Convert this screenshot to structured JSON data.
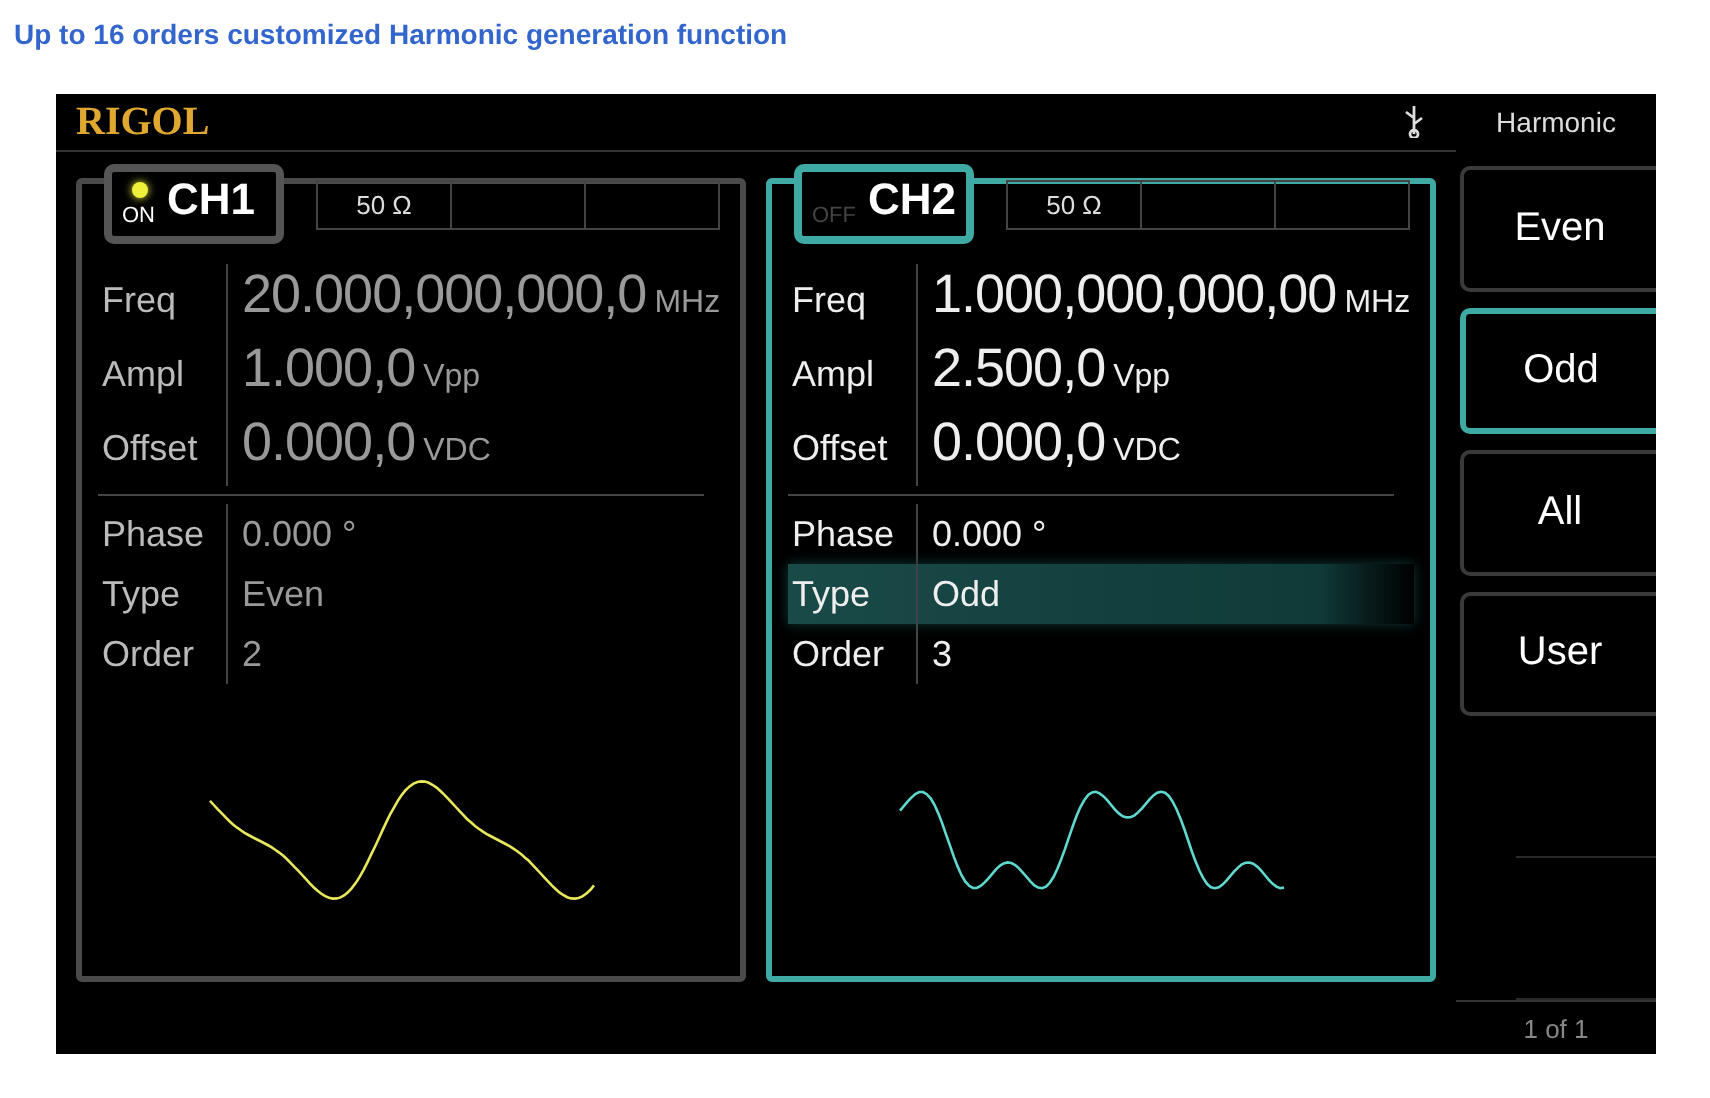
{
  "heading": "Up to 16 orders customized Harmonic generation function",
  "logo": "RIGOL",
  "channels": [
    {
      "name": "CH1",
      "output": "ON",
      "on": true,
      "selected": false,
      "color": "#e8e85a",
      "impedance": "50 Ω",
      "params": [
        {
          "kind": "large",
          "label": "Freq",
          "value": "20.000,000,000,0",
          "unit": "MHz",
          "selected": false
        },
        {
          "kind": "large",
          "label": "Ampl",
          "value": "1.000,0",
          "unit": "Vpp",
          "selected": false
        },
        {
          "kind": "large",
          "label": "Offset",
          "value": "0.000,0",
          "unit": "VDC",
          "selected": false
        },
        {
          "kind": "small",
          "label": "Phase",
          "value": "0.000 °",
          "selected": false
        },
        {
          "kind": "small",
          "label": "Type",
          "value": "Even",
          "selected": false
        },
        {
          "kind": "small",
          "label": "Order",
          "value": "2",
          "selected": false
        }
      ]
    },
    {
      "name": "CH2",
      "output": "OFF",
      "on": false,
      "selected": true,
      "color": "#5fd8d0",
      "impedance": "50 Ω",
      "params": [
        {
          "kind": "large",
          "label": "Freq",
          "value": "1.000,000,000,00",
          "unit": "MHz",
          "selected": false
        },
        {
          "kind": "large",
          "label": "Ampl",
          "value": "2.500,0",
          "unit": "Vpp",
          "selected": false
        },
        {
          "kind": "large",
          "label": "Offset",
          "value": "0.000,0",
          "unit": "VDC",
          "selected": false
        },
        {
          "kind": "small",
          "label": "Phase",
          "value": "0.000 °",
          "selected": false
        },
        {
          "kind": "small",
          "label": "Type",
          "value": "Odd",
          "selected": true
        },
        {
          "kind": "small",
          "label": "Order",
          "value": "3",
          "selected": false
        }
      ]
    }
  ],
  "menu": {
    "title": "Harmonic",
    "page": "1 of 1",
    "softkeys": [
      {
        "label": "Even",
        "selected": false
      },
      {
        "label": "Odd",
        "selected": true
      },
      {
        "label": "All",
        "selected": false
      },
      {
        "label": "User",
        "selected": false
      }
    ]
  }
}
